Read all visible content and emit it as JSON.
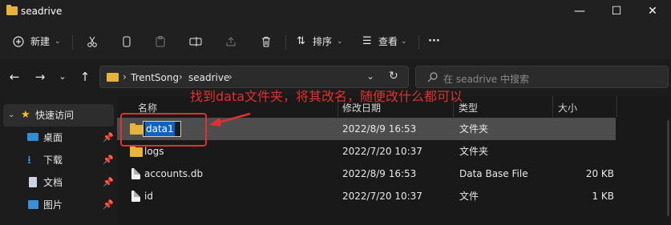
{
  "window": {
    "title": "seadrive",
    "minimize_glyph": "—",
    "maximize_glyph": "☐",
    "close_glyph": "✕"
  },
  "toolbar": {
    "new_label": "新建",
    "sort_label": "排序",
    "view_label": "查看",
    "more_label": "···"
  },
  "address": {
    "segments": [
      "TrentSong",
      "seadrive"
    ],
    "search_placeholder": "在 seadrive 中搜索"
  },
  "nav_pane": {
    "quick_access": "快速访问",
    "items": [
      {
        "label": "桌面",
        "icon": "desktop-icon"
      },
      {
        "label": "下载",
        "icon": "download-icon"
      },
      {
        "label": "文档",
        "icon": "document-icon"
      },
      {
        "label": "图片",
        "icon": "picture-icon"
      }
    ]
  },
  "columns": {
    "name": "名称",
    "date": "修改日期",
    "type": "类型",
    "size": "大小"
  },
  "files": [
    {
      "name": "data1",
      "date": "2022/8/9 16:53",
      "type": "文件夹",
      "size": "",
      "icon": "folder-icon",
      "renaming": true
    },
    {
      "name": "logs",
      "date": "2022/7/20 10:37",
      "type": "文件夹",
      "size": "",
      "icon": "folder-icon"
    },
    {
      "name": "accounts.db",
      "date": "2022/8/9 16:53",
      "type": "Data Base File",
      "size": "20 KB",
      "icon": "db-file-icon"
    },
    {
      "name": "id",
      "date": "2022/7/20 10:37",
      "type": "文件",
      "size": "1 KB",
      "icon": "file-icon"
    }
  ],
  "annotation": {
    "text": "找到data文件夹，将其改名，随便改什么都可以",
    "color": "#e03030"
  },
  "colors": {
    "accent_folder": "#e8b339",
    "selected_row": "#4d4d4d",
    "annotation_red": "#e03030"
  }
}
